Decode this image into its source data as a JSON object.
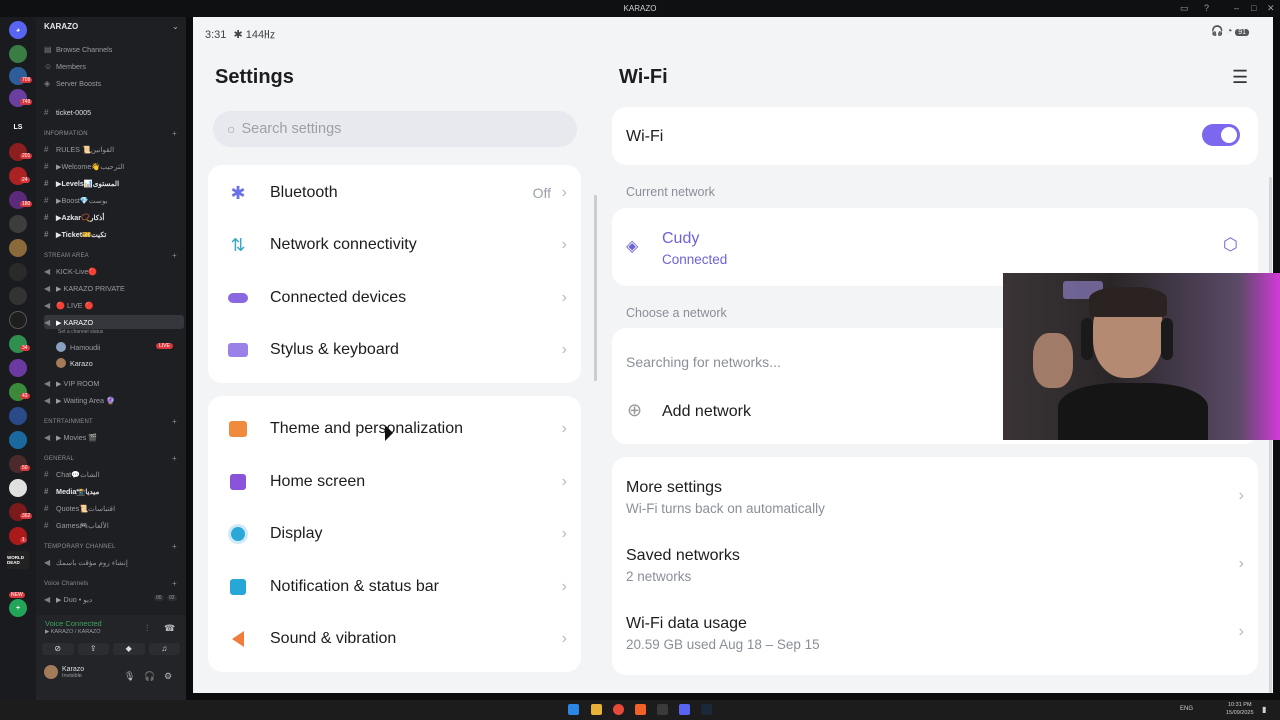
{
  "window": {
    "title": "KARAZO"
  },
  "discord": {
    "guild": "KARAZO",
    "top_items": [
      "Browse Channels",
      "Members",
      "Server Boosts"
    ],
    "ticket_channel": "ticket-0005",
    "categories": {
      "information": "INFORMATION",
      "stream": "STREAM AREA",
      "entertainment": "ENTRTAINMENT",
      "general": "GENERAL",
      "temporary": "TEMPORARY CHANNEL",
      "voice": "Voice Channels"
    },
    "info_channels": [
      "RULES 📜القوانين",
      "▶Welcome👋الترحيب",
      "▶Levels📊المستوى",
      "▶Boost💎بوست",
      "▶Azkar📿أذكار",
      "▶Ticket🎫تكيت"
    ],
    "stream_channels": [
      "KICK-Live🔴",
      "▶ KARAZO PRIVATE",
      "🔴 LIVE 🔴",
      "▶ KARAZO"
    ],
    "channel_status": "Set a channel status",
    "voice_users": [
      {
        "name": "Hamoudii",
        "badge": "LIVE"
      },
      {
        "name": "Karazo"
      }
    ],
    "more_channels": [
      "▶ VIP ROOM",
      "▶ Waiting Area 🔮"
    ],
    "ent_channels": [
      "▶ Movies 🎬"
    ],
    "general_channels": [
      "Chat💬الشات",
      "Media📸ميديا",
      "Quotes📜اقتباسات",
      "Games🎮الألعاب"
    ],
    "temp_channel": "إنشاء روم مؤقت باسمك",
    "duo_channel": "▶ Duo • ديو",
    "duo_counts": [
      "00",
      "02"
    ],
    "voice_connected": "Voice Connected",
    "voice_location": "▶ KARAZO / KARAZO",
    "user": {
      "name": "Karazo",
      "status": "Invisible"
    },
    "rail_labels": [
      "LS",
      "WORLD DEAD",
      "NEW"
    ],
    "rail_badges": [
      "709",
      "749",
      "201",
      "24",
      "180",
      "34",
      "43",
      "50",
      "362",
      "1"
    ]
  },
  "phone": {
    "time": "3:31",
    "status_extra": "✱ 144㎐",
    "battery": "91",
    "settings": {
      "title": "Settings",
      "search_placeholder": "Search settings",
      "group1": [
        {
          "label": "Bluetooth",
          "value": "Off",
          "icon": "bluetooth-icon",
          "glyph": "✱",
          "color": "#6b72e8"
        },
        {
          "label": "Network connectivity",
          "icon": "network-icon",
          "glyph": "⇅",
          "color": "#3aa8c9"
        },
        {
          "label": "Connected devices",
          "icon": "devices-icon",
          "glyph": "⊂⊃",
          "color": "#8a68e0"
        },
        {
          "label": "Stylus & keyboard",
          "icon": "keyboard-icon",
          "glyph": "⌨",
          "color": "#8a68e0"
        }
      ],
      "group2": [
        {
          "label": "Theme and personalization",
          "icon": "theme-icon",
          "glyph": "👕",
          "color": "#f08a3c"
        },
        {
          "label": "Home screen",
          "icon": "home-icon",
          "glyph": "⌂",
          "color": "#8a52d8"
        },
        {
          "label": "Display",
          "icon": "display-icon",
          "glyph": "☀",
          "color": "#2aa8d8"
        },
        {
          "label": "Notification & status bar",
          "icon": "notification-icon",
          "glyph": "▣",
          "color": "#27a6d8"
        },
        {
          "label": "Sound & vibration",
          "icon": "sound-icon",
          "glyph": "🔊",
          "color": "#f07d3c"
        }
      ]
    },
    "wifi": {
      "title": "Wi-Fi",
      "toggle_label": "Wi-Fi",
      "toggle_on": true,
      "current_section": "Current network",
      "current_name": "Cudy",
      "current_status": "Connected",
      "choose_section": "Choose a network",
      "searching": "Searching for networks...",
      "add_network": "Add network",
      "more": [
        {
          "title": "More settings",
          "sub": "Wi-Fi turns back on automatically"
        },
        {
          "title": "Saved networks",
          "sub": "2 networks"
        },
        {
          "title": "Wi-Fi data usage",
          "sub": "20.59 GB used Aug 18 – Sep 15"
        }
      ],
      "accent": "#7b68ee"
    }
  },
  "taskbar": {
    "lang": "ENG",
    "time": "10:31 PM",
    "date": "15/09/2025"
  }
}
